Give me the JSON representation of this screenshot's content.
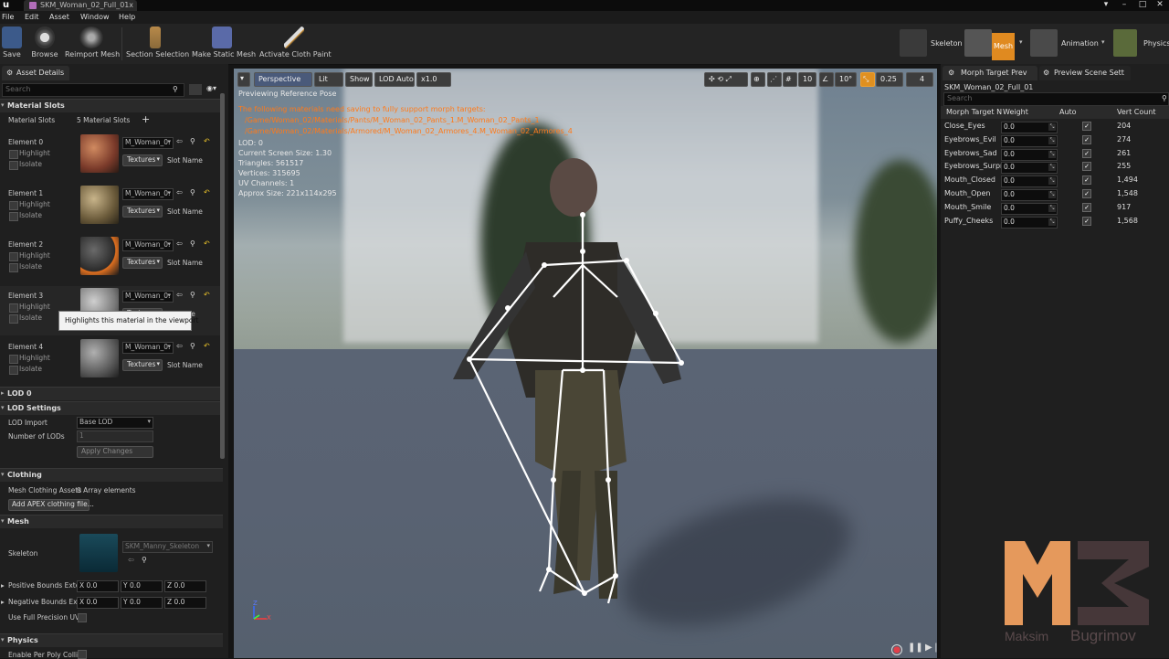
{
  "window": {
    "title": "SKM_Woman_02_Full_01",
    "logo": "u",
    "close": "x"
  },
  "menu": [
    "File",
    "Edit",
    "Asset",
    "Window",
    "Help"
  ],
  "toolbar": {
    "buttons": [
      "Save",
      "Browse",
      "Reimport Mesh",
      "Section Selection",
      "Make Static Mesh",
      "Activate Cloth Paint"
    ],
    "modes": [
      "Skeleton",
      "Mesh",
      "Animation",
      "Physics"
    ]
  },
  "asset_details": {
    "tab": "Asset Details",
    "search_placeholder": "Search",
    "material_slots": {
      "header": "Material Slots",
      "label": "Material Slots",
      "count": "5 Material Slots",
      "elements": [
        {
          "name": "Element 0",
          "material": "M_Woman_0:",
          "highlight": "Highlight",
          "isolate": "Isolate",
          "textures": "Textures",
          "slot": "Slot Name"
        },
        {
          "name": "Element 1",
          "material": "M_Woman_0:",
          "highlight": "Highlight",
          "isolate": "Isolate",
          "textures": "Textures",
          "slot": "Slot Name"
        },
        {
          "name": "Element 2",
          "material": "M_Woman_0:",
          "highlight": "Highlight",
          "isolate": "Isolate",
          "textures": "Textures",
          "slot": "Slot Name"
        },
        {
          "name": "Element 3",
          "material": "M_Woman_0:",
          "highlight": "Highlight",
          "isolate": "Isolate",
          "textures": "Textures",
          "slot": "me"
        },
        {
          "name": "Element 4",
          "material": "M_Woman_0:",
          "highlight": "Highlight",
          "isolate": "Isolate",
          "textures": "Textures",
          "slot": "Slot Name"
        }
      ],
      "tooltip": "Highlights this material in the viewport"
    },
    "lod0": "LOD 0",
    "lod_settings": {
      "header": "LOD Settings",
      "lod_import_label": "LOD Import",
      "lod_import_value": "Base LOD",
      "num_lods_label": "Number of LODs",
      "num_lods_value": "1",
      "apply": "Apply Changes"
    },
    "clothing": {
      "header": "Clothing",
      "assets_label": "Mesh Clothing Assets",
      "assets_value": "0 Array elements",
      "add_button": "Add APEX clothing file..."
    },
    "mesh": {
      "header": "Mesh",
      "skeleton_label": "Skeleton",
      "skeleton_value": "SKM_Manny_Skeleton",
      "pos_bounds_label": "Positive Bounds Exte",
      "neg_bounds_label": "Negative Bounds Exte",
      "pos_bounds": {
        "x": "X 0.0",
        "y": "Y 0.0",
        "z": "Z 0.0"
      },
      "neg_bounds": {
        "x": "X 0.0",
        "y": "Y 0.0",
        "z": "Z 0.0"
      },
      "full_precision_label": "Use Full Precision UV"
    },
    "physics": {
      "header": "Physics",
      "per_poly_label": "Enable Per Poly Collis"
    }
  },
  "viewport": {
    "dropdown": "▾",
    "perspective": "Perspective",
    "lit": "Lit",
    "show": "Show",
    "lod": "LOD Auto",
    "speed": "x1.0",
    "grid_size": "10",
    "rotation_snap": "10°",
    "scale_snap": "0.25",
    "camera_speed": "4",
    "pose_text": "Previewing Reference Pose",
    "warning": [
      "The following materials need saving to fully support morph targets:",
      "/Game/Woman_02/Materials/Pants/M_Woman_02_Pants_1.M_Woman_02_Pants_1",
      "/Game/Woman_02/Materials/Armored/M_Woman_02_Armores_4.M_Woman_02_Armores_4"
    ],
    "stats": [
      "LOD: 0",
      "Current Screen Size: 1.30",
      "Triangles: 561517",
      "Vertices: 315695",
      "UV Channels: 1",
      "Approx Size: 221x114x295"
    ],
    "axis": {
      "x": "X",
      "z": "Z"
    }
  },
  "morph_panel": {
    "tabs": [
      "Morph Target Prev",
      "Preview Scene Sett"
    ],
    "asset_name": "SKM_Woman_02_Full_01",
    "search_placeholder": "Search",
    "columns": [
      "Morph Target N",
      "Weight",
      "Auto",
      "Vert Count"
    ],
    "rows": [
      {
        "name": "Close_Eyes",
        "weight": "0.0",
        "vert": "204"
      },
      {
        "name": "Eyebrows_Evil",
        "weight": "0.0",
        "vert": "274"
      },
      {
        "name": "Eyebrows_Sad",
        "weight": "0.0",
        "vert": "261"
      },
      {
        "name": "Eyebrows_Surpri",
        "weight": "0.0",
        "vert": "255"
      },
      {
        "name": "Mouth_Closed",
        "weight": "0.0",
        "vert": "1,494"
      },
      {
        "name": "Mouth_Open",
        "weight": "0.0",
        "vert": "1,548"
      },
      {
        "name": "Mouth_Smile",
        "weight": "0.0",
        "vert": "917"
      },
      {
        "name": "Puffy_Cheeks",
        "weight": "0.0",
        "vert": "1,568"
      }
    ]
  },
  "watermark": {
    "first": "Maksim",
    "last": "Bugrimov",
    "accent": "#f0a060"
  },
  "colors": {
    "accent": "#e09020",
    "warning": "#ff7a1a"
  }
}
